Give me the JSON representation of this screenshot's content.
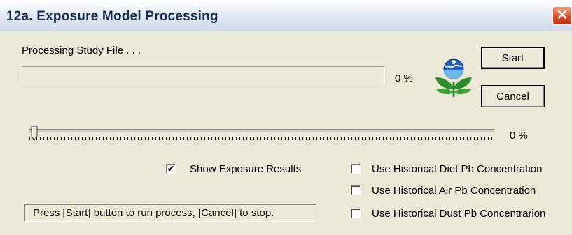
{
  "window": {
    "title": "12a. Exposure Model Processing",
    "close_glyph": "✕"
  },
  "processing": {
    "label": "Processing Study File . . .",
    "progress_percent_label": "0 %",
    "progress_fraction": 0
  },
  "buttons": {
    "start": "Start",
    "cancel": "Cancel"
  },
  "slider": {
    "value_label": "0 %",
    "value_fraction": 0
  },
  "options": {
    "show_exposure_results": {
      "label": "Show Exposure Results",
      "checked": true
    },
    "historical_diet": {
      "label": "Use Historical Diet Pb Concentration",
      "checked": false
    },
    "historical_air": {
      "label": "Use Historical Air Pb Concentration",
      "checked": false
    },
    "historical_dust": {
      "label": "Use Historical Dust Pb Concentrarion",
      "checked": false
    }
  },
  "status_text": "Press [Start] button to run process, [Cancel] to stop.",
  "icons": {
    "logo": "epa-logo-icon",
    "close": "close-icon",
    "check": "check-icon"
  },
  "colors": {
    "close_button": "#d94d2a",
    "logo_green": "#2f8a2c",
    "logo_blue": "#1c5fbf",
    "progress": "#316ac5"
  }
}
